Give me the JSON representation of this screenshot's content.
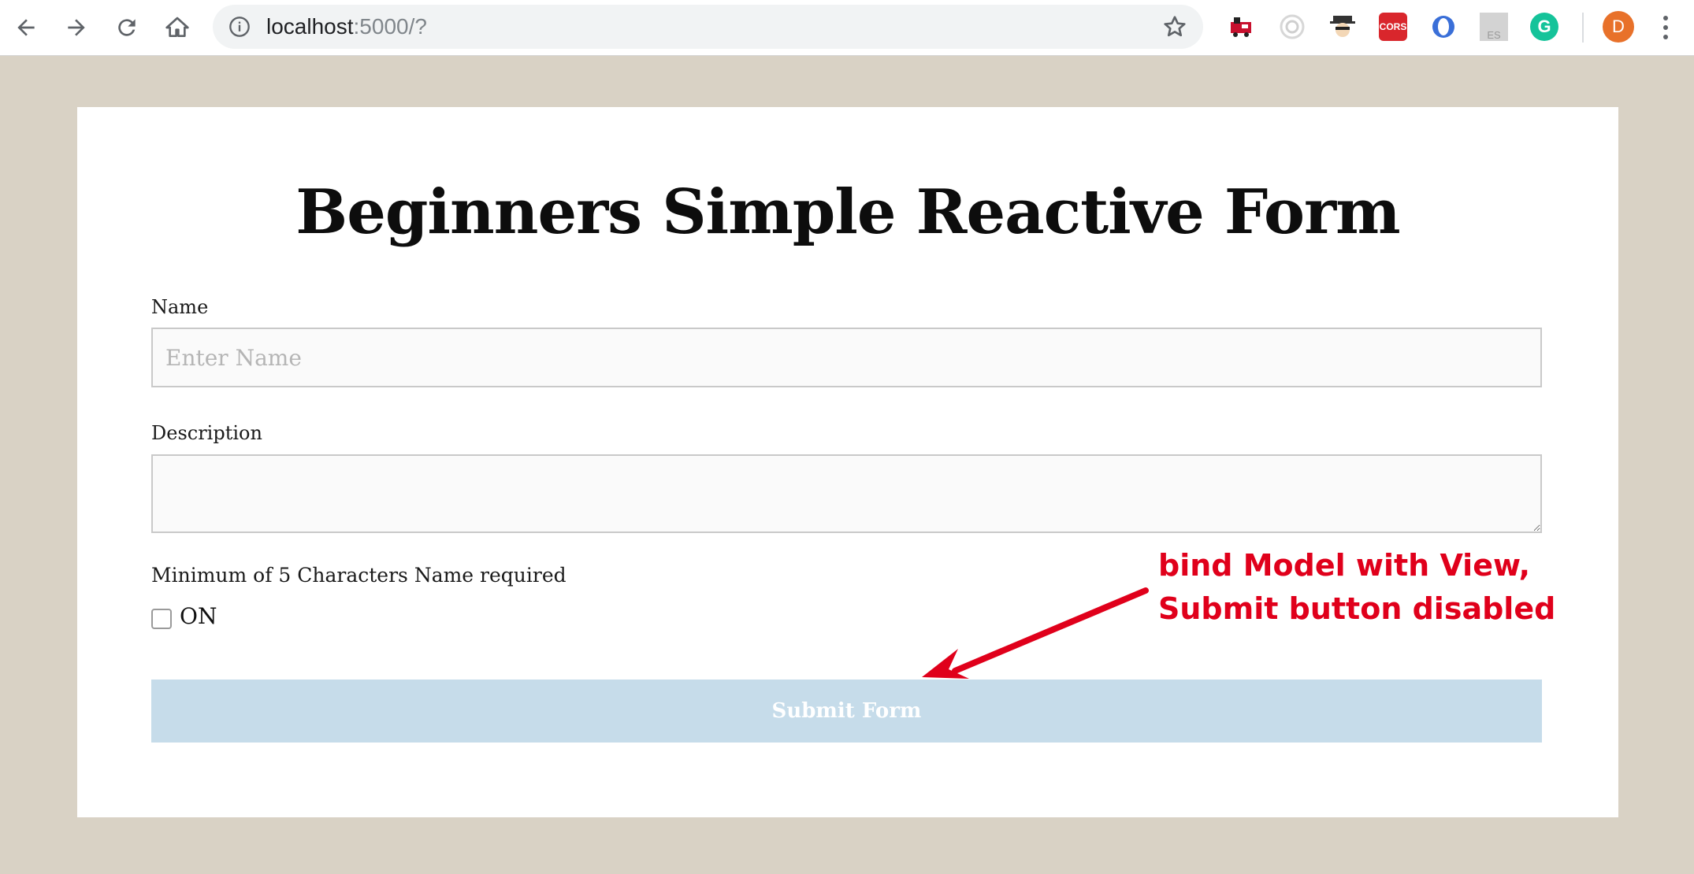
{
  "browser": {
    "url_host": "localhost",
    "url_path": ":5000/?",
    "profile_initial": "D",
    "extensions": [
      "train-extension-icon",
      "eye-extension-icon",
      "spy-extension-icon",
      "cors-extension-icon",
      "ring-extension-icon",
      "es-extension-icon",
      "grammarly-extension-icon"
    ],
    "extension_labels": {
      "cors": "CORS",
      "es": "ES",
      "grammarly": "G"
    }
  },
  "form": {
    "title": "Beginners Simple Reactive Form",
    "name_label": "Name",
    "name_placeholder": "Enter Name",
    "name_value": "",
    "description_label": "Description",
    "description_value": "",
    "hint": "Minimum of 5 Characters Name required",
    "checkbox_label": "ON",
    "checkbox_checked": false,
    "submit_label": "Submit Form",
    "submit_disabled": true
  },
  "annotation": {
    "line1": "bind Model with View,",
    "line2": "Submit button disabled",
    "color": "#e0001b"
  },
  "colors": {
    "page_background": "#d9d2c5",
    "submit_disabled": "#c6dcea"
  }
}
